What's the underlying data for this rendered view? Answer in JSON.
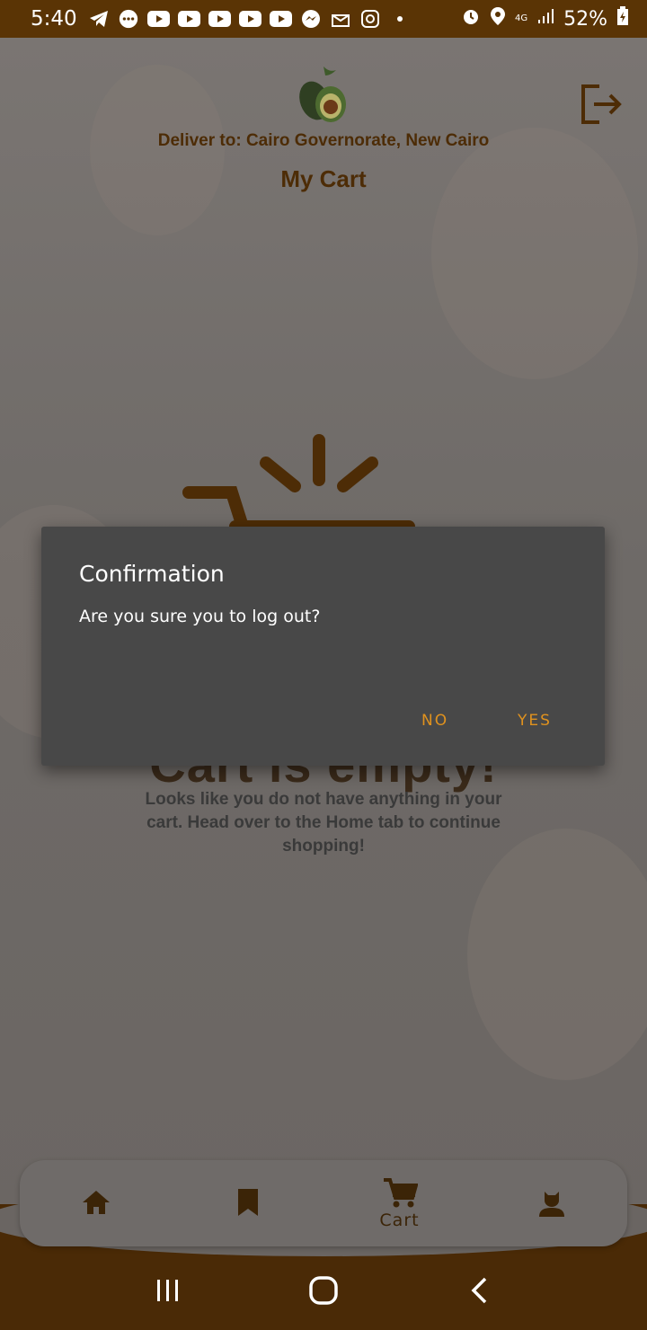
{
  "status_bar": {
    "time": "5:40",
    "network": "4G",
    "battery": "52%"
  },
  "header": {
    "deliver_to": "Deliver to: Cairo Governorate, New Cairo",
    "title": "My Cart"
  },
  "empty_state": {
    "title": "Cart is empty!",
    "description": "Looks like you do not have anything in your cart. Head over to the Home tab to continue shopping!"
  },
  "bottom_nav": {
    "items": [
      {
        "icon": "home-icon",
        "label": ""
      },
      {
        "icon": "bookmark-icon",
        "label": ""
      },
      {
        "icon": "cart-icon",
        "label": "Cart"
      },
      {
        "icon": "person-icon",
        "label": ""
      }
    ],
    "active": "Cart"
  },
  "dialog": {
    "title": "Confirmation",
    "message": "Are you sure you to log out?",
    "no_label": "NO",
    "yes_label": "YES"
  },
  "colors": {
    "brand_brown": "#5a3405",
    "accent_orange": "#e0921e",
    "dialog_bg": "#484848"
  }
}
